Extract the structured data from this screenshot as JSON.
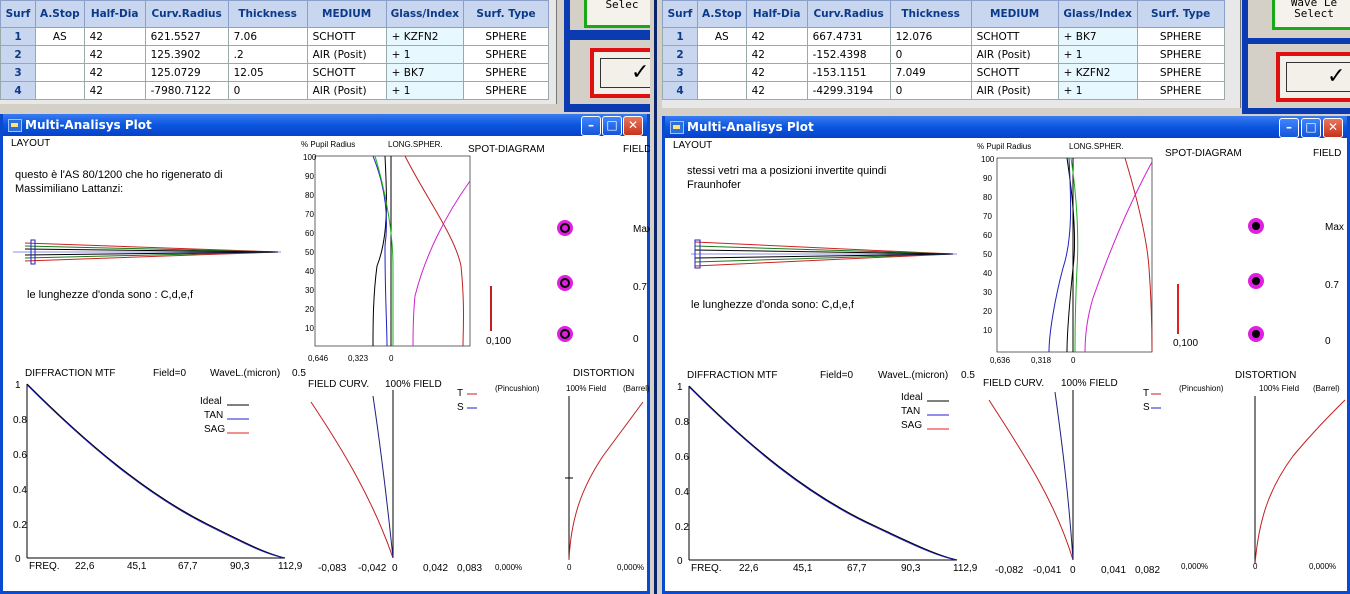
{
  "left": {
    "table": {
      "headers": [
        "Surf",
        "A.Stop",
        "Half-Dia",
        "Curv.Radius",
        "Thickness",
        "MEDIUM",
        "Glass/Index",
        "Surf. Type"
      ],
      "rows": [
        {
          "n": "1",
          "stop": "AS",
          "dia": "42",
          "rad": "621.5527",
          "thk": "7.06",
          "med": "SCHOTT",
          "glass": "+ KZFN2",
          "type": "SPHERE"
        },
        {
          "n": "2",
          "stop": "",
          "dia": "42",
          "rad": "125.3902",
          "thk": ".2",
          "med": "AIR (Posit)",
          "glass": "+ 1",
          "type": "SPHERE"
        },
        {
          "n": "3",
          "stop": "",
          "dia": "42",
          "rad": "125.0729",
          "thk": "12.05",
          "med": "SCHOTT",
          "glass": "+ BK7",
          "type": "SPHERE"
        },
        {
          "n": "4",
          "stop": "",
          "dia": "42",
          "rad": "-7980.7122",
          "thk": "0",
          "med": "AIR (Posit)",
          "glass": "+ 1",
          "type": "SPHERE"
        }
      ]
    },
    "wave_button": {
      "line1": "",
      "line2": "Selec"
    },
    "ok_button": "✓",
    "window": {
      "title": "Multi-Analisys Plot",
      "layout": "LAYOUT",
      "note": "questo è l'AS 80/1200 che ho rigenerato di Massimiliano Lattanzi:",
      "wavelengths": "le lunghezze d'onda sono : C,d,e,f",
      "pupil_label": "% Pupil Radius",
      "long_spher": "LONG.SPHER.",
      "pupil_ticks": [
        "100",
        "90",
        "80",
        "70",
        "60",
        "50",
        "40",
        "30",
        "20",
        "10"
      ],
      "long_x_ticks": [
        "0,646",
        "0,323",
        "0"
      ],
      "spot_title": "SPOT-DIAGRAM",
      "field_title": "FIELD",
      "spot_field_labels": [
        "Max",
        "0.7",
        "0"
      ],
      "spot_scale": "0,100",
      "mtf_title": "DIFFRACTION  MTF",
      "mtf_field": "Field=0",
      "mtf_wave": "WaveL.(micron)",
      "mtf_wave_value": "0.5",
      "mtf_legend": [
        "Ideal",
        "TAN",
        "SAG"
      ],
      "mtf_y_ticks": [
        "1",
        "0.8",
        "0.6",
        "0.4",
        "0.2",
        "0"
      ],
      "mtf_x_ticks": [
        "FREQ.",
        "22,6",
        "45,1",
        "67,7",
        "90,3",
        "112,9"
      ],
      "fc_title": "FIELD CURV.",
      "fc_field": "100% FIELD",
      "fc_legend": [
        "T",
        "S"
      ],
      "fc_x_ticks": [
        "-0,083",
        "-0,042",
        "0",
        "0,042",
        "0,083"
      ],
      "dist_title": "DISTORTION",
      "dist_pin": "(Pincushion)",
      "dist_field": "100% Field",
      "dist_barrel": "(Barrel)",
      "dist_x_ticks": [
        "0,000%",
        "0",
        "0,000%"
      ]
    }
  },
  "right": {
    "table": {
      "headers": [
        "Surf",
        "A.Stop",
        "Half-Dia",
        "Curv.Radius",
        "Thickness",
        "MEDIUM",
        "Glass/Index",
        "Surf. Type"
      ],
      "rows": [
        {
          "n": "1",
          "stop": "AS",
          "dia": "42",
          "rad": "667.4731",
          "thk": "12.076",
          "med": "SCHOTT",
          "glass": "+ BK7",
          "type": "SPHERE"
        },
        {
          "n": "2",
          "stop": "",
          "dia": "42",
          "rad": "-152.4398",
          "thk": "0",
          "med": "AIR (Posit)",
          "glass": "+ 1",
          "type": "SPHERE"
        },
        {
          "n": "3",
          "stop": "",
          "dia": "42",
          "rad": "-153.1151",
          "thk": "7.049",
          "med": "SCHOTT",
          "glass": "+ KZFN2",
          "type": "SPHERE"
        },
        {
          "n": "4",
          "stop": "",
          "dia": "42",
          "rad": "-4299.3194",
          "thk": "0",
          "med": "AIR (Posit)",
          "glass": "+ 1",
          "type": "SPHERE"
        }
      ]
    },
    "wave_button": {
      "line1": "Wave Le",
      "line2": "Select"
    },
    "ok_button": "✓",
    "window": {
      "title": "Multi-Analisys Plot",
      "layout": "LAYOUT",
      "note": "stessi vetri ma a posizioni invertite quindi Fraunhofer",
      "wavelengths": "le lunghezze d'onda sono: C,d,e,f",
      "pupil_label": "% Pupil Radius",
      "long_spher": "LONG.SPHER.",
      "pupil_ticks": [
        "100",
        "90",
        "80",
        "70",
        "60",
        "50",
        "40",
        "30",
        "20",
        "10"
      ],
      "long_x_ticks": [
        "0,636",
        "0,318",
        "0"
      ],
      "spot_title": "SPOT-DIAGRAM",
      "field_title": "FIELD",
      "spot_field_labels": [
        "Max",
        "0.7",
        "0"
      ],
      "spot_scale": "0,100",
      "mtf_title": "DIFFRACTION  MTF",
      "mtf_field": "Field=0",
      "mtf_wave": "WaveL.(micron)",
      "mtf_wave_value": "0.5",
      "mtf_legend": [
        "Ideal",
        "TAN",
        "SAG"
      ],
      "mtf_y_ticks": [
        "1",
        "0.8",
        "0.6",
        "0.4",
        "0.2",
        "0"
      ],
      "mtf_x_ticks": [
        "FREQ.",
        "22,6",
        "45,1",
        "67,7",
        "90,3",
        "112,9"
      ],
      "fc_title": "FIELD CURV.",
      "fc_field": "100% FIELD",
      "fc_legend": [
        "T",
        "S"
      ],
      "fc_x_ticks": [
        "-0,082",
        "-0,041",
        "0",
        "0,041",
        "0,082"
      ],
      "dist_title": "DISTORTION",
      "dist_pin": "(Pincushion)",
      "dist_field": "100% Field",
      "dist_barrel": "(Barrel)",
      "dist_x_ticks": [
        "0,000%",
        "0",
        "0,000%"
      ]
    }
  },
  "colors": {
    "title_bar": "#0a56e0",
    "accent_red": "#e01010",
    "accent_green": "#18a818",
    "mtf_ideal": "#000000",
    "mtf_tan": "#2020d0",
    "mtf_sag": "#e02020",
    "magenta": "#e020e0"
  }
}
